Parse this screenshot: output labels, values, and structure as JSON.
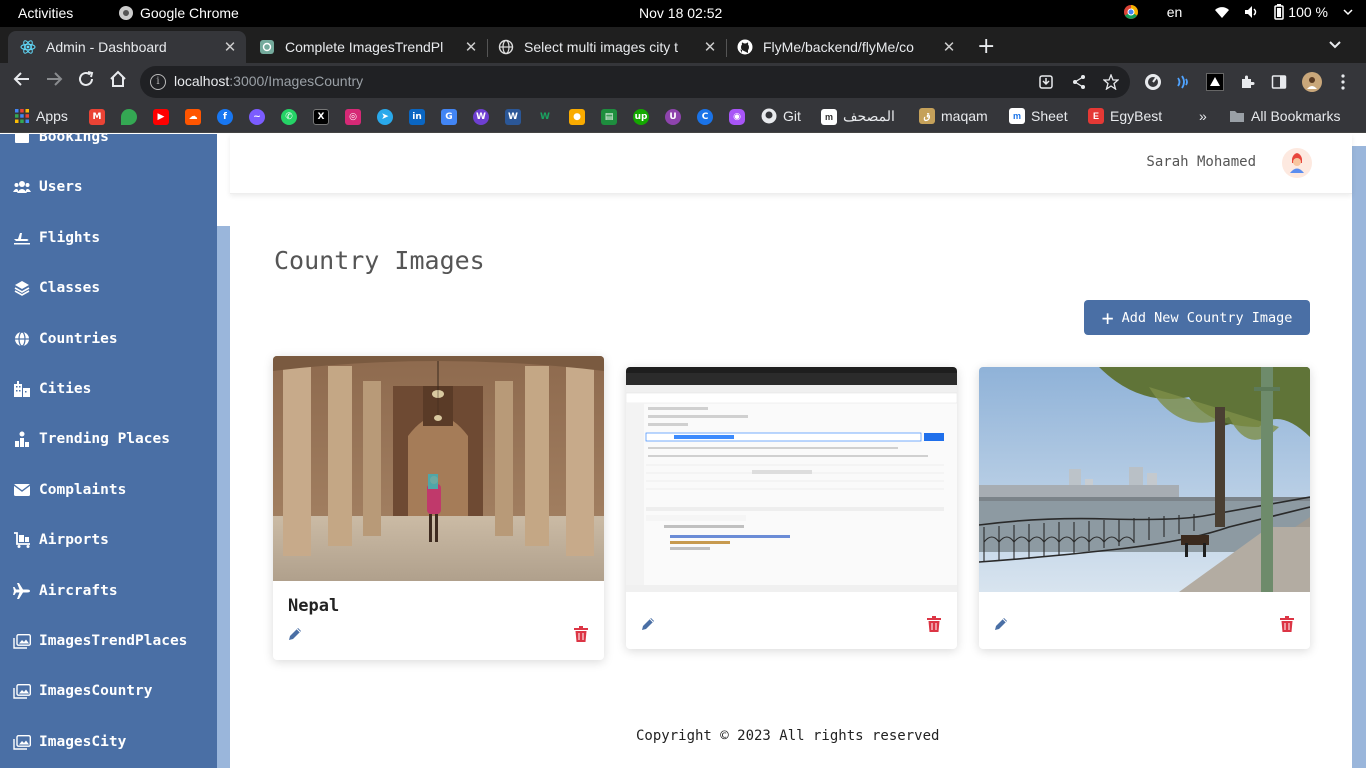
{
  "system": {
    "activities": "Activities",
    "app_name": "Google Chrome",
    "clock": "Nov 18  02:52",
    "lang": "en",
    "battery": "100 %"
  },
  "tabs": [
    {
      "title": "Admin - Dashboard",
      "active": true
    },
    {
      "title": "Complete ImagesTrendPl",
      "active": false
    },
    {
      "title": "Select multi images city t",
      "active": false
    },
    {
      "title": "FlyMe/backend/flyMe/co",
      "active": false
    }
  ],
  "address": {
    "host": "localhost",
    "path": ":3000/ImagesCountry"
  },
  "bookmarks": {
    "apps": "Apps",
    "items": [
      "Git",
      "المصحف",
      "maqam",
      "Sheet",
      "EgyBest"
    ],
    "more": "»",
    "all": "All Bookmarks"
  },
  "sidebar": {
    "items": [
      {
        "label": "Bookings",
        "icon": "bookings-icon"
      },
      {
        "label": "Users",
        "icon": "users-icon"
      },
      {
        "label": "Flights",
        "icon": "plane-departure-icon"
      },
      {
        "label": "Classes",
        "icon": "layers-icon"
      },
      {
        "label": "Countries",
        "icon": "globe-icon"
      },
      {
        "label": "Cities",
        "icon": "city-icon"
      },
      {
        "label": "Trending Places",
        "icon": "trending-icon"
      },
      {
        "label": "Complaints",
        "icon": "envelope-icon"
      },
      {
        "label": "Airports",
        "icon": "luggage-cart-icon"
      },
      {
        "label": "Aircrafts",
        "icon": "plane-icon"
      },
      {
        "label": "ImagesTrendPlaces",
        "icon": "images-icon"
      },
      {
        "label": "ImagesCountry",
        "icon": "images-icon"
      },
      {
        "label": "ImagesCity",
        "icon": "images-icon"
      }
    ]
  },
  "header": {
    "username": "Sarah Mohamed"
  },
  "main": {
    "title": "Country Images",
    "add_button": "Add New Country Image",
    "cards": [
      {
        "name": "Nepal",
        "image": "mosque-arcade-photo"
      },
      {
        "name": "",
        "image": "postman-screenshot"
      },
      {
        "name": "",
        "image": "nile-corniche-photo"
      }
    ]
  },
  "footer": {
    "copyright": "Copyright © 2023 All rights reserved"
  },
  "colors": {
    "sidebar": "#4a6fa5",
    "accent": "#4a6fa5",
    "delete": "#dc3545"
  }
}
